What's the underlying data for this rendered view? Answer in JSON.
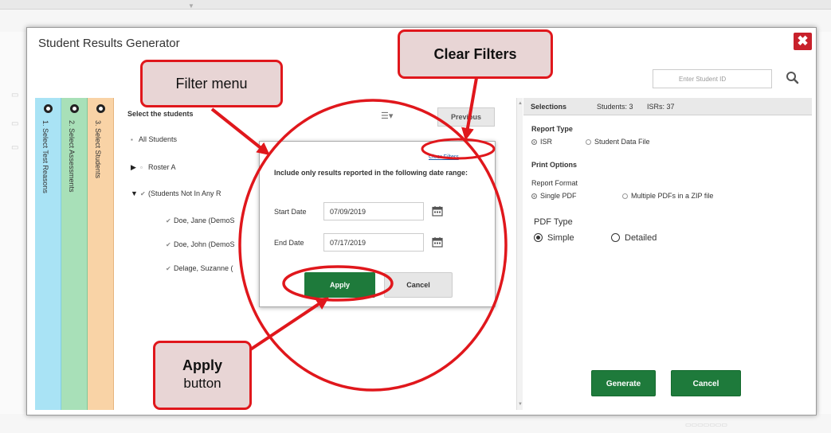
{
  "window": {
    "title": "Student Results Generator",
    "close_icon": "close-icon"
  },
  "search": {
    "placeholder": "Enter Student ID"
  },
  "steps": [
    {
      "number": "1.",
      "label": "1. Select Test Reasons"
    },
    {
      "number": "2.",
      "label": "2. Select Assessments"
    },
    {
      "number": "3.",
      "label": "3. Select Students"
    }
  ],
  "students_panel": {
    "heading": "Select the students",
    "previous_label": "Previous",
    "all_students": "All Students",
    "roster": "Roster A",
    "group": "(Students Not In Any R",
    "students": [
      "Doe, Jane (DemoS",
      "Doe, John (DemoS",
      "Delage, Suzanne ("
    ]
  },
  "filter_popover": {
    "clear_filters_link": "Clear Filters",
    "description": "Include only results reported in the following date range:",
    "start_label": "Start Date",
    "start_value": "07/09/2019",
    "end_label": "End Date",
    "end_value": "07/17/2019",
    "apply_label": "Apply",
    "cancel_label": "Cancel"
  },
  "selections": {
    "tab_label": "Selections",
    "students_count": "Students: 3",
    "isrs_count": "ISRs: 37",
    "report_type_label": "Report Type",
    "report_type_options": [
      "ISR",
      "Student Data File"
    ],
    "report_type_selected": "ISR",
    "print_options_label": "Print Options",
    "report_format_label": "Report Format",
    "report_format_options": [
      "Single PDF",
      "Multiple PDFs in a ZIP file"
    ],
    "report_format_selected": "Single PDF",
    "pdf_type_label": "PDF Type",
    "pdf_type_options": [
      "Simple",
      "Detailed"
    ],
    "pdf_type_selected": "Simple",
    "generate_label": "Generate",
    "cancel_label": "Cancel"
  },
  "annotations": {
    "filter_menu": "Filter menu",
    "clear_filters": "Clear Filters",
    "apply_title": "Apply",
    "apply_sub": "button",
    "color": "#e0171c",
    "fill": "#e8d5d5"
  },
  "colors": {
    "step1": "#a9e3f5",
    "step2": "#a8e0b8",
    "step3": "#f9d3a6",
    "primary_button": "#1e7a3b",
    "close_button": "#c8212b"
  }
}
